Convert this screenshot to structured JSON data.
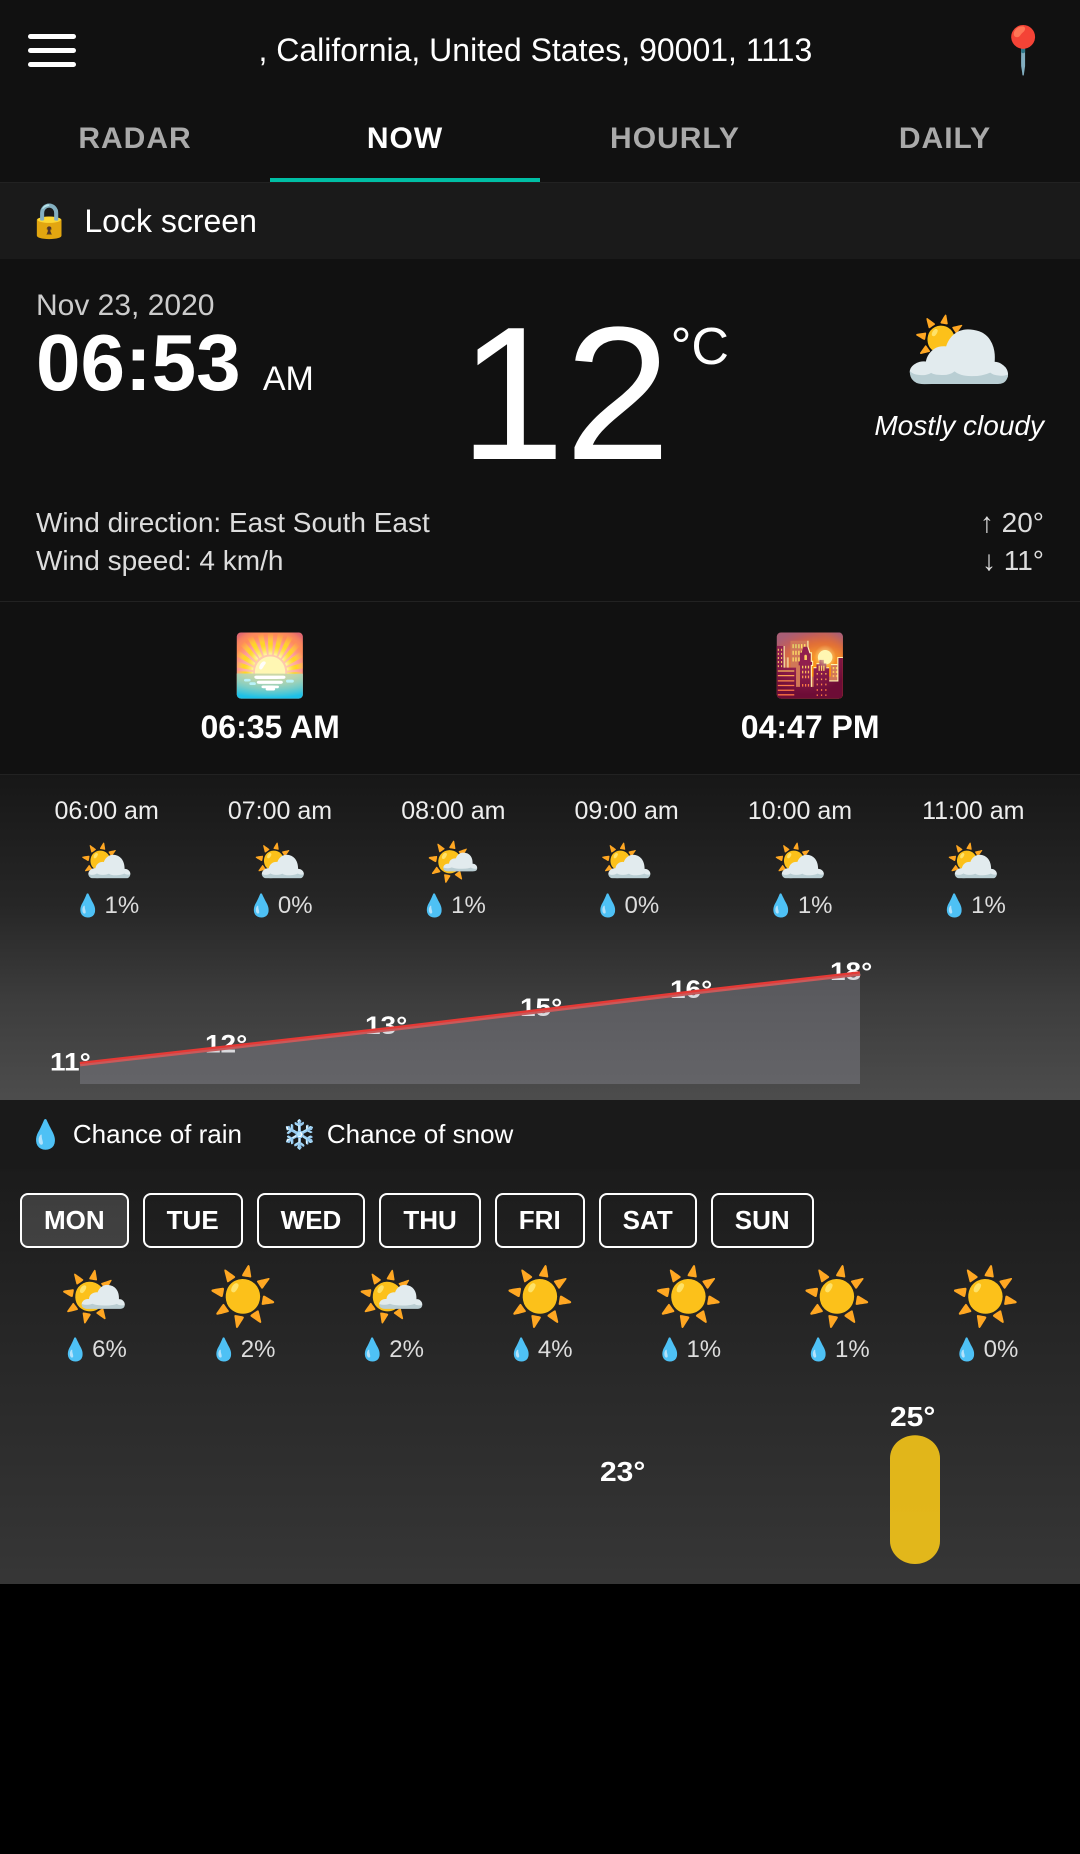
{
  "header": {
    "location": ", California, United States, 90001, 1113",
    "hamburger_label": "menu",
    "location_pin_label": "location"
  },
  "nav": {
    "tabs": [
      {
        "label": "RADAR",
        "active": false
      },
      {
        "label": "NOW",
        "active": true
      },
      {
        "label": "HOURLY",
        "active": false
      },
      {
        "label": "DAILY",
        "active": false
      }
    ]
  },
  "lock_screen": {
    "label": "Lock screen"
  },
  "current": {
    "date": "Nov 23, 2020",
    "time": "06:53",
    "ampm": "AM",
    "temp": "12",
    "temp_unit": "°C",
    "weather_desc": "Mostly cloudy",
    "wind_direction_label": "Wind direction: East South East",
    "wind_speed_label": "Wind speed: 4 km/h",
    "high": "↑ 20°",
    "low": "↓ 11°"
  },
  "sun_times": {
    "sunrise": "06:35 AM",
    "sunset": "04:47 PM"
  },
  "hourly": {
    "hours": [
      {
        "time": "06:00 am",
        "precip": "1%",
        "temp": 11
      },
      {
        "time": "07:00 am",
        "precip": "0%",
        "temp": 12
      },
      {
        "time": "08:00 am",
        "precip": "1%",
        "temp": 13
      },
      {
        "time": "09:00 am",
        "precip": "0%",
        "temp": 15
      },
      {
        "time": "10:00 am",
        "precip": "1%",
        "temp": 16
      },
      {
        "time": "11:00 am",
        "precip": "1%",
        "temp": 18
      }
    ]
  },
  "legend": {
    "rain_label": "Chance of rain",
    "snow_label": "Chance of snow"
  },
  "daily": {
    "days": [
      {
        "label": "MON",
        "precip": "6%",
        "active": true
      },
      {
        "label": "TUE",
        "precip": "2%",
        "active": false
      },
      {
        "label": "WED",
        "precip": "2%",
        "active": false
      },
      {
        "label": "THU",
        "precip": "4%",
        "active": false
      },
      {
        "label": "FRI",
        "precip": "1%",
        "active": false
      },
      {
        "label": "SAT",
        "precip": "1%",
        "active": false
      },
      {
        "label": "SUN",
        "precip": "0%",
        "active": false
      }
    ],
    "temp_high": "25°",
    "temp_low": "23°"
  }
}
